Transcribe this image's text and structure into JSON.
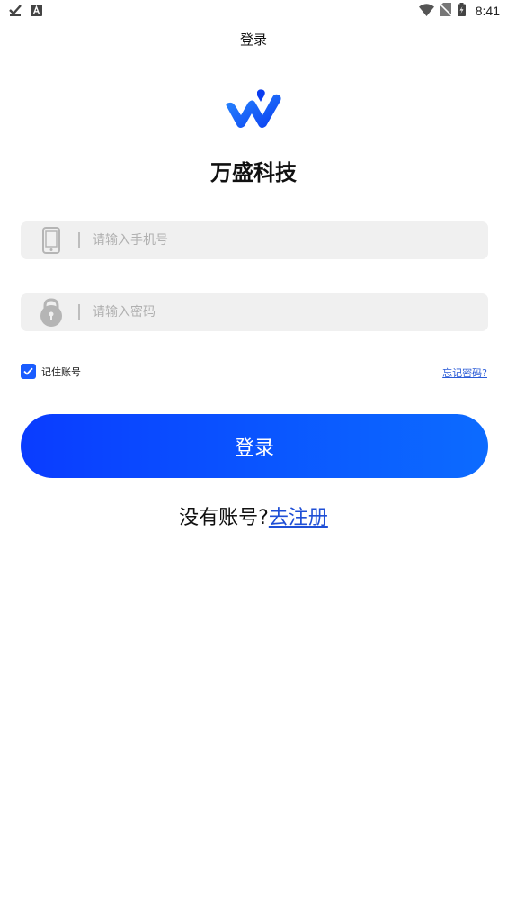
{
  "status_bar": {
    "time": "8:41",
    "icons": [
      "check-icon",
      "a-icon",
      "wifi-icon",
      "no-sim-icon",
      "battery-icon"
    ]
  },
  "header": {
    "title": "登录"
  },
  "brand": {
    "name": "万盛科技",
    "accent": "#1a5cff"
  },
  "form": {
    "phone_placeholder": "请输入手机号",
    "password_placeholder": "请输入密码",
    "remember_label": "记住账号",
    "remember_checked": true,
    "forgot_label": "忘记密码?"
  },
  "login_button": {
    "label": "登录"
  },
  "register": {
    "prompt": "没有账号?",
    "link": "去注册"
  }
}
